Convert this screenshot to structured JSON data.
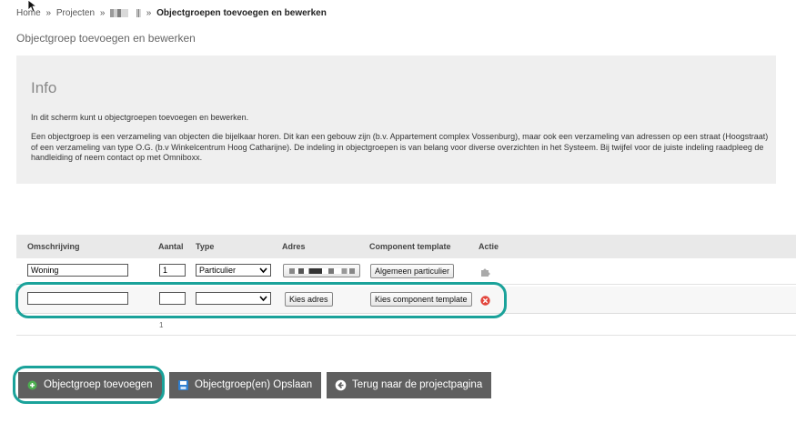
{
  "breadcrumb": {
    "home": "Home",
    "projects": "Projecten",
    "separator": "»",
    "current": "Objectgroepen toevoegen en bewerken"
  },
  "page_title": "Objectgroep toevoegen en bewerken",
  "info": {
    "heading": "Info",
    "paragraph1": "In dit scherm kunt u objectgroepen toevoegen en bewerken.",
    "paragraph2": "Een objectgroep is een verzameling van objecten die bijelkaar horen. Dit kan een gebouw zijn (b.v. Appartement complex Vossenburg), maar ook een verzameling van adressen op een straat (Hoogstraat) of een verzameling van type O.G. (b.v Winkelcentrum Hoog Catharijne). De indeling in objectgroepen is van belang voor diverse overzichten in het Systeem. Bij twijfel voor de juiste indeling raadpleeg de handleiding of neem contact op met Omniboxx."
  },
  "table": {
    "headers": {
      "description": "Omschrijving",
      "count": "Aantal",
      "type": "Type",
      "address": "Adres",
      "component_template": "Component template",
      "action": "Actie"
    },
    "rows": [
      {
        "description": "Woning",
        "count": "1",
        "type": "Particulier",
        "component_template": "Algemeen particulier"
      },
      {
        "description": "",
        "count": "",
        "type": "",
        "address_button": "Kies adres",
        "component_template_button": "Kies component template"
      }
    ],
    "total": "1"
  },
  "buttons": {
    "add_group": "Objectgroep toevoegen",
    "save_groups": "Objectgroep(en) Opslaan",
    "back": "Terug naar de projectpagina"
  },
  "colors": {
    "highlight": "#1aa29a",
    "button_bg": "#5f5f5f",
    "info_bg": "#efefef",
    "header_bg": "#e9e9e9",
    "add_icon": "#4caf50",
    "save_icon": "#2f7fd0",
    "delete_icon": "#e2453c"
  },
  "icons": {
    "add": "plus-circle-icon",
    "save": "floppy-disk-icon",
    "back": "arrow-left-circle-icon",
    "component": "puzzle-piece-icon",
    "delete": "close-circle-icon",
    "cursor": "mouse-pointer-icon"
  }
}
